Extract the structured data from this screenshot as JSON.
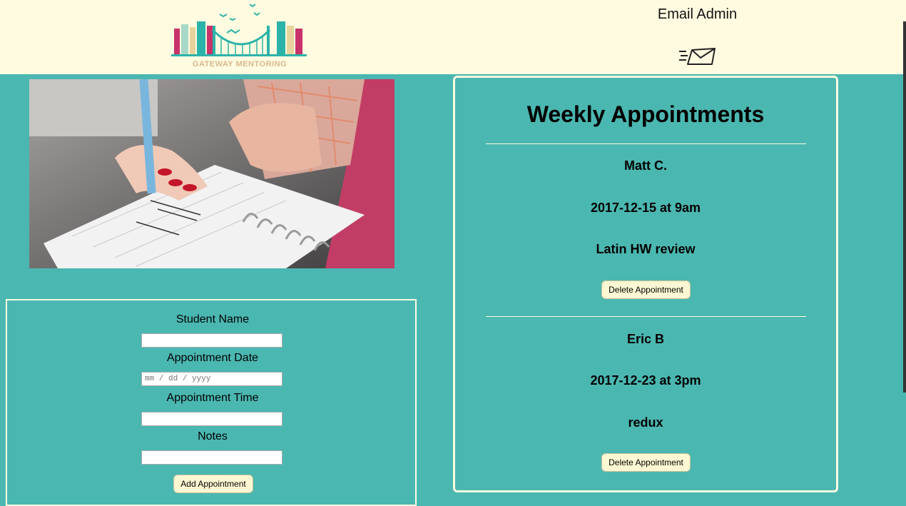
{
  "header": {
    "logo_text": "GATEWAY MENTORING",
    "email_admin_label": "Email Admin",
    "mail_icon": "envelope-icon"
  },
  "form": {
    "student_name_label": "Student Name",
    "student_name_value": "",
    "appointment_date_label": "Appointment Date",
    "appointment_date_placeholder": "mm / dd / yyyy",
    "appointment_time_label": "Appointment Time",
    "appointment_time_value": "",
    "notes_label": "Notes",
    "notes_value": "",
    "add_button_label": "Add Appointment"
  },
  "appointments": {
    "title": "Weekly Appointments",
    "items": [
      {
        "student": "Matt C.",
        "when": "2017-12-15 at 9am",
        "notes": "Latin HW review",
        "delete_label": "Delete Appointment"
      },
      {
        "student": "Eric B",
        "when": "2017-12-23 at 3pm",
        "notes": "redux",
        "delete_label": "Delete Appointment"
      }
    ]
  },
  "colors": {
    "background": "#4bb7b1",
    "header_bg": "#fffbe0",
    "button_bg": "#fdf8d3",
    "accent_pink": "#c8336a"
  }
}
